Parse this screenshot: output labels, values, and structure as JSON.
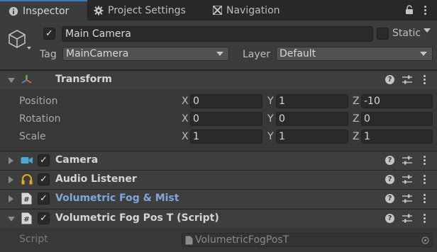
{
  "tabs": [
    {
      "label": "Inspector",
      "icon": "info-icon",
      "active": true
    },
    {
      "label": "Project Settings",
      "icon": "gear-icon",
      "active": false
    },
    {
      "label": "Navigation",
      "icon": "navigation-icon",
      "active": false
    }
  ],
  "header": {
    "active_checked": true,
    "name": "Main Camera",
    "static_label": "Static",
    "static_checked": false,
    "tag_label": "Tag",
    "tag_value": "MainCamera",
    "layer_label": "Layer",
    "layer_value": "Default"
  },
  "transform": {
    "title": "Transform",
    "rows": [
      {
        "label": "Position",
        "x": "0",
        "y": "1",
        "z": "-10"
      },
      {
        "label": "Rotation",
        "x": "0",
        "y": "0",
        "z": "0"
      },
      {
        "label": "Scale",
        "x": "1",
        "y": "1",
        "z": "1"
      }
    ],
    "axes": [
      "X",
      "Y",
      "Z"
    ]
  },
  "components": [
    {
      "title": "Camera",
      "icon": "camera-icon",
      "checked": true
    },
    {
      "title": "Audio Listener",
      "icon": "headphones-icon",
      "checked": true
    },
    {
      "title": "Volumetric Fog & Mist",
      "icon": "script-icon",
      "checked": true,
      "highlight_color": "#7ea7dc"
    },
    {
      "title": "Volumetric Fog Pos T (Script)",
      "icon": "script-icon",
      "checked": true
    }
  ],
  "script_row": {
    "label": "Script",
    "value": "VolumetricFogPosT"
  },
  "colors": {
    "accent": "#3a79bb",
    "link_title": "#7ea7dc"
  }
}
